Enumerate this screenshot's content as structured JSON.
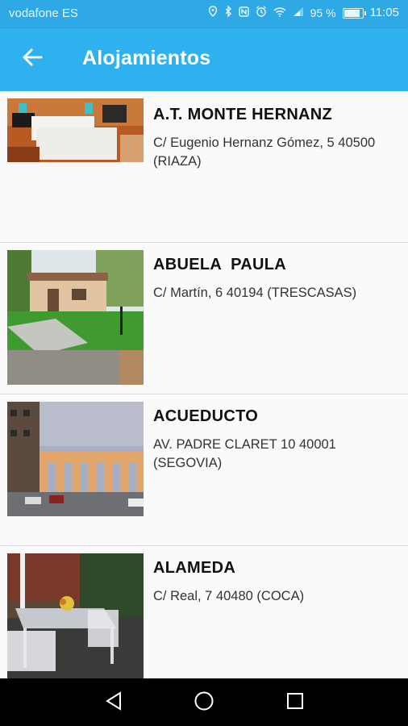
{
  "status_bar": {
    "carrier": "vodafone ES",
    "battery_text": "95 %",
    "battery_level": 0.95,
    "time": "11:05",
    "icons": [
      "location-icon",
      "bluetooth-icon",
      "nfc-icon",
      "alarm-icon",
      "wifi-icon",
      "signal-icon",
      "battery-icon"
    ]
  },
  "app_bar": {
    "title": "Alojamientos",
    "back_icon": "arrow-left-icon"
  },
  "listings": [
    {
      "name": "A.T. MONTE HERNANZ",
      "address": "C/ Eugenio Hernanz Gómez, 5 40500 (RIAZA)",
      "image": "bedroom-photo"
    },
    {
      "name": "ABUELA  PAULA",
      "address": "C/ Martín, 6 40194 (TRESCASAS)",
      "image": "house-garden-photo"
    },
    {
      "name": "ACUEDUCTO",
      "address": "AV. PADRE CLARET 10 40001 (SEGOVIA)",
      "image": "aqueduct-photo"
    },
    {
      "name": "ALAMEDA",
      "address": "C/ Real, 7 40480 (COCA)",
      "image": "terrace-photo"
    }
  ],
  "nav_bar": {
    "icons": [
      "back-triangle-icon",
      "home-circle-icon",
      "recents-square-icon"
    ]
  },
  "colors": {
    "status_bar": "#2fa9e6",
    "app_bar": "#2fb1ef",
    "nav_bar": "#000000"
  }
}
